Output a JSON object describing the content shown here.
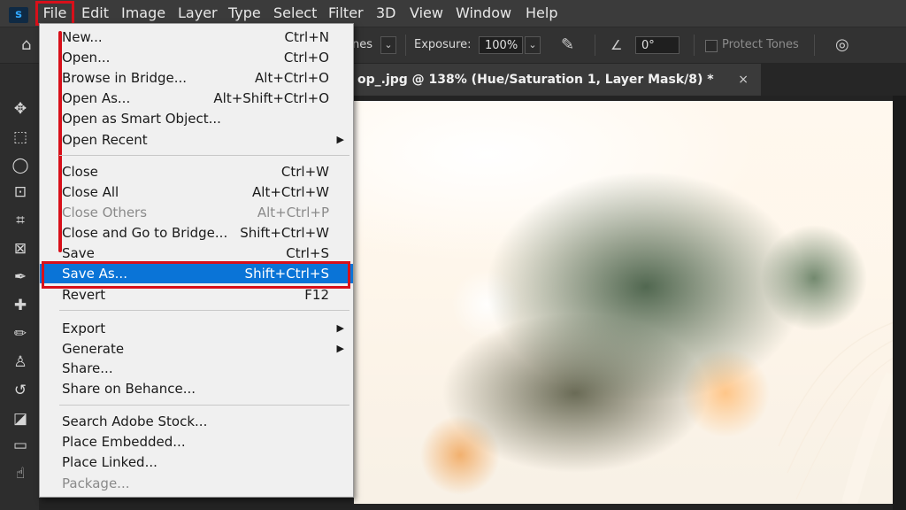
{
  "app": {
    "logo": "s"
  },
  "menubar": {
    "items": [
      "File",
      "Edit",
      "Image",
      "Layer",
      "Type",
      "Select",
      "Filter",
      "3D",
      "View",
      "Window",
      "Help"
    ]
  },
  "options": {
    "mode_fragment": "nes",
    "exposure_label": "Exposure:",
    "exposure_value": "100%",
    "angle_value": "0°",
    "protect_tones": "Protect Tones"
  },
  "document": {
    "tab_title": "op_.jpg @ 138% (Hue/Saturation 1, Layer Mask/8) *",
    "close": "×"
  },
  "file_menu": {
    "items": [
      {
        "label": "New...",
        "shortcut": "Ctrl+N"
      },
      {
        "label": "Open...",
        "shortcut": "Ctrl+O"
      },
      {
        "label": "Browse in Bridge...",
        "shortcut": "Alt+Ctrl+O"
      },
      {
        "label": "Open As...",
        "shortcut": "Alt+Shift+Ctrl+O"
      },
      {
        "label": "Open as Smart Object...",
        "shortcut": ""
      },
      {
        "label": "Open Recent",
        "shortcut": "",
        "submenu": true
      },
      {
        "label": "Close",
        "shortcut": "Ctrl+W"
      },
      {
        "label": "Close All",
        "shortcut": "Alt+Ctrl+W"
      },
      {
        "label": "Close Others",
        "shortcut": "Alt+Ctrl+P",
        "disabled": true
      },
      {
        "label": "Close and Go to Bridge...",
        "shortcut": "Shift+Ctrl+W"
      },
      {
        "label": "Save",
        "shortcut": "Ctrl+S"
      },
      {
        "label": "Save As...",
        "shortcut": "Shift+Ctrl+S",
        "selected": true
      },
      {
        "label": "Revert",
        "shortcut": "F12"
      },
      {
        "label": "Export",
        "shortcut": "",
        "submenu": true
      },
      {
        "label": "Generate",
        "shortcut": "",
        "submenu": true
      },
      {
        "label": "Share...",
        "shortcut": ""
      },
      {
        "label": "Share on Behance...",
        "shortcut": ""
      },
      {
        "label": "Search Adobe Stock...",
        "shortcut": ""
      },
      {
        "label": "Place Embedded...",
        "shortcut": ""
      },
      {
        "label": "Place Linked...",
        "shortcut": ""
      },
      {
        "label": "Package...",
        "shortcut": "",
        "disabled": true
      }
    ]
  },
  "colors": {
    "highlight": "#0a74d7",
    "annotation_red": "#d8101a"
  }
}
